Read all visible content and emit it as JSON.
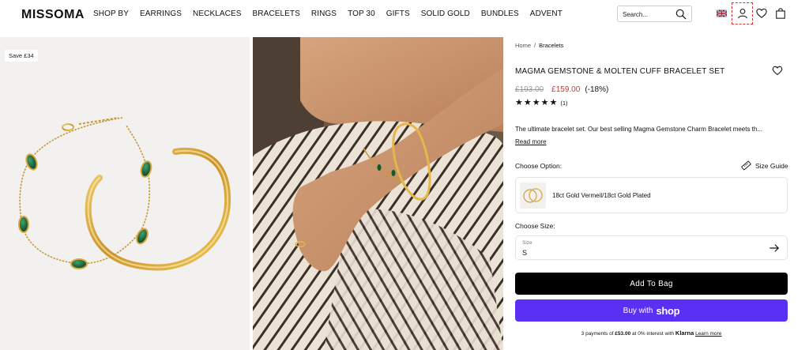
{
  "header": {
    "logo": "MISSOMA",
    "nav": [
      "SHOP BY",
      "EARRINGS",
      "NECKLACES",
      "BRACELETS",
      "RINGS",
      "TOP 30",
      "GIFTS",
      "SOLID GOLD",
      "BUNDLES",
      "ADVENT"
    ],
    "search_placeholder": "Search...",
    "icons": [
      "search-icon",
      "uk-flag-icon",
      "account-icon",
      "wishlist-icon",
      "bag-icon"
    ]
  },
  "gallery": {
    "save_badge": "Save £34"
  },
  "product": {
    "breadcrumb": [
      "Home",
      "Bracelets"
    ],
    "breadcrumb_sep": "/",
    "title": "MAGMA GEMSTONE & MOLTEN CUFF BRACELET SET",
    "old_price": "£193.00",
    "new_price": "£159.00",
    "discount": "(-18%)",
    "rating": 5,
    "stars": [
      "★",
      "★",
      "★",
      "★",
      "★"
    ],
    "review_count": "(1)",
    "description": "The ultimate bracelet set. Our best selling Magma Gemstone Charm Bracelet meets th...",
    "read_more": "Read more",
    "choose_option_label": "Choose Option:",
    "size_guide": "Size Guide",
    "option_label": "18ct Gold Vermeil/18ct Gold Plated",
    "choose_size_label": "Choose Size:",
    "size_field_label": "Size",
    "size_value": "S",
    "add_to_bag": "Add To Bag",
    "shop_pay_prefix": "Buy with",
    "shop_pay_brand": "shop",
    "klarna": {
      "text_a": "3 payments of ",
      "amount": "£53.00",
      "text_b": " at 0% interest with ",
      "brand": "Klarna",
      "learn_more": "Learn more"
    }
  },
  "colors": {
    "sale_red": "#d9322e",
    "shop_purple": "#5a31f4",
    "black": "#000000"
  }
}
